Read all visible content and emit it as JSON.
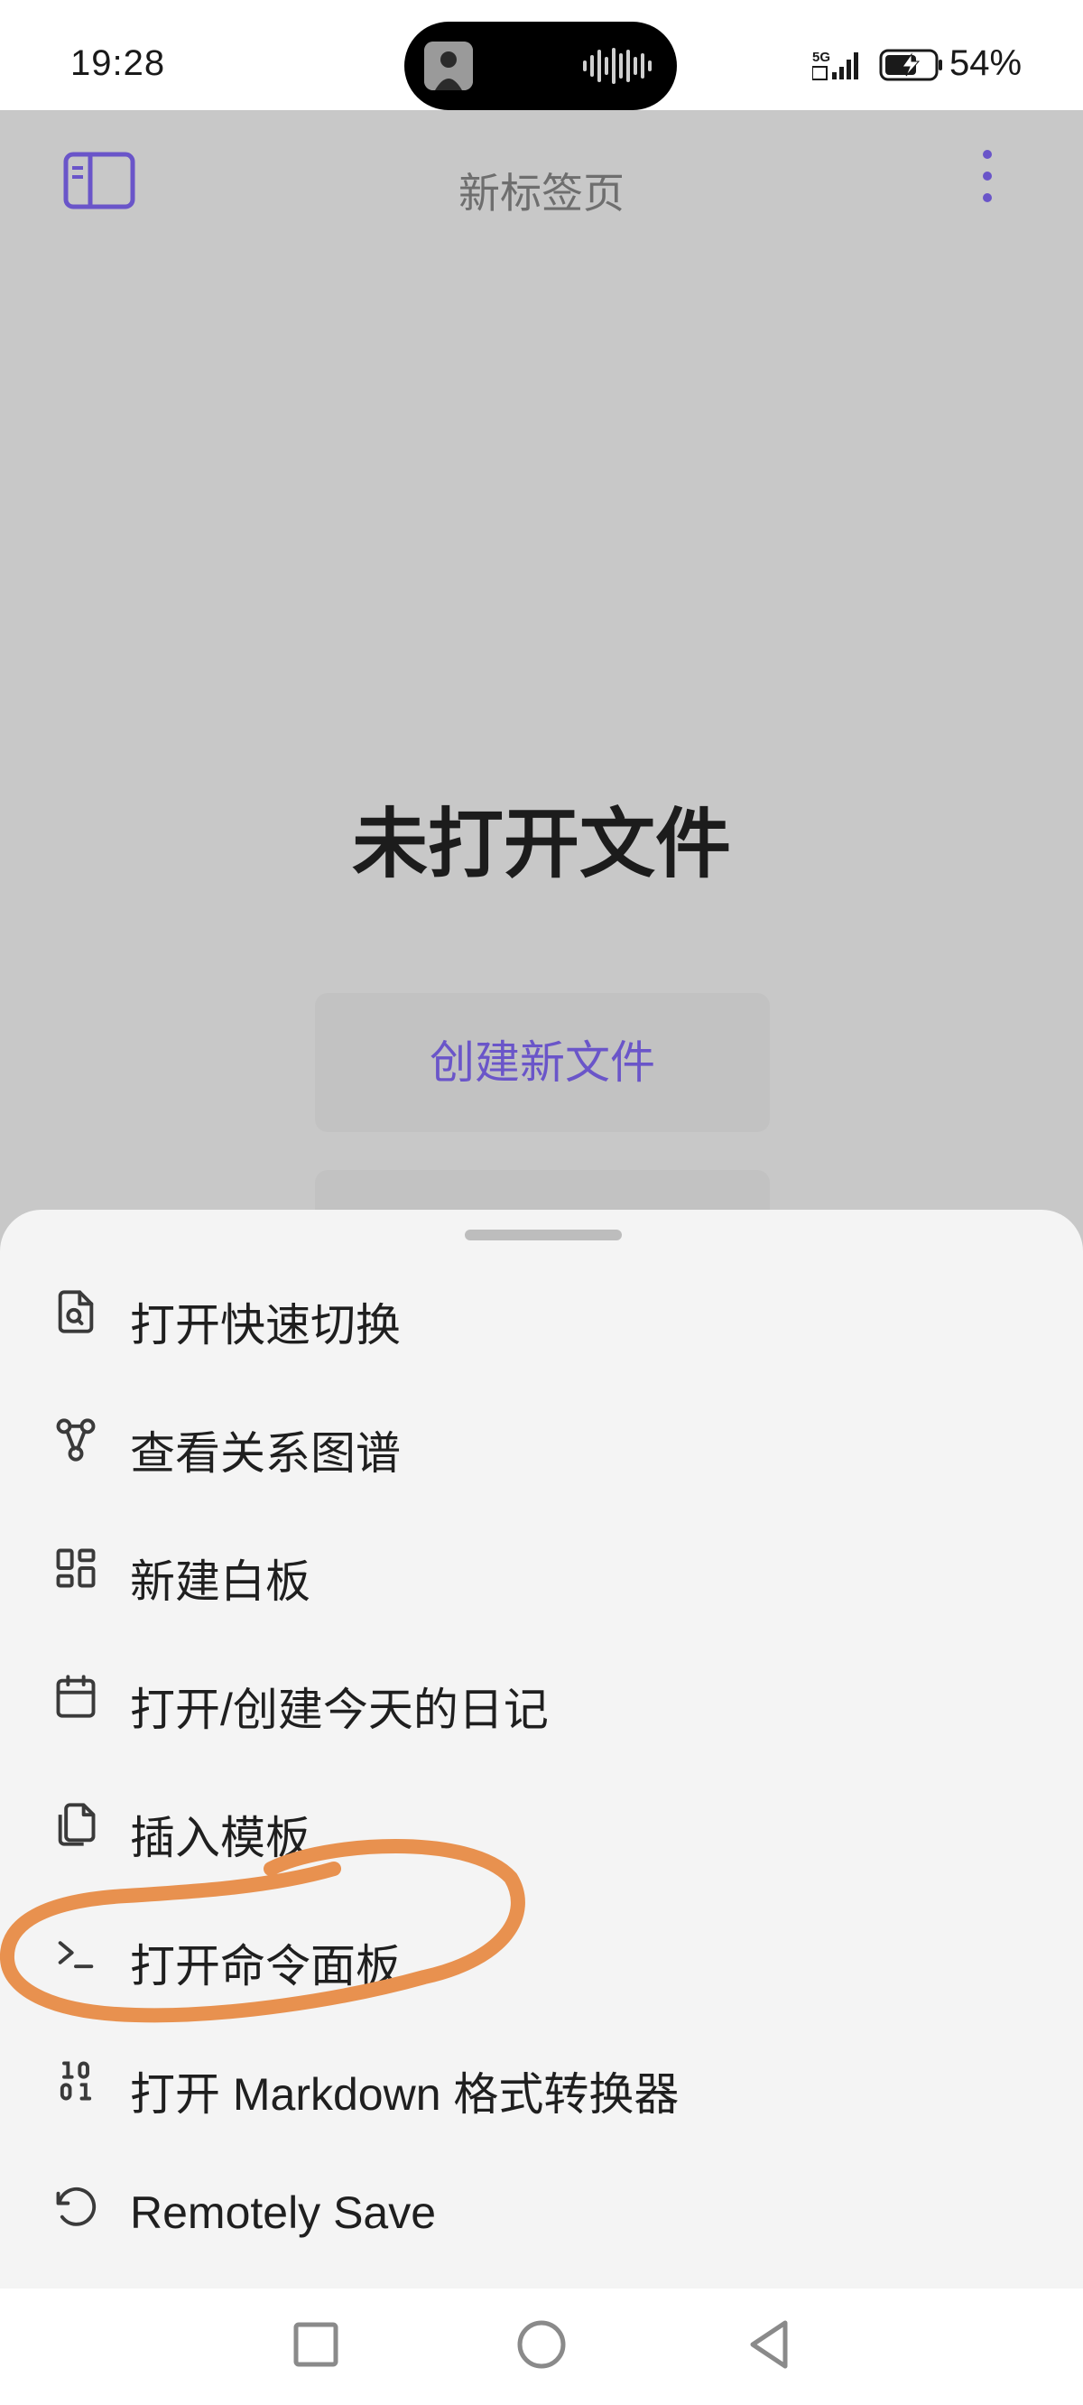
{
  "status_bar": {
    "time": "19:28",
    "signal_label": "5G",
    "battery": "54%"
  },
  "header": {
    "title": "新标签页",
    "sidebar_icon": "sidebar-icon",
    "more_icon": "more-vertical-icon"
  },
  "empty_state": {
    "title": "未打开文件",
    "create_button": "创建新文件"
  },
  "menu": {
    "items": [
      {
        "label": "打开快速切换",
        "icon": "file-search-icon"
      },
      {
        "label": "查看关系图谱",
        "icon": "graph-icon"
      },
      {
        "label": "新建白板",
        "icon": "canvas-icon"
      },
      {
        "label": "打开/创建今天的日记",
        "icon": "calendar-icon"
      },
      {
        "label": "插入模板",
        "icon": "copy-icon"
      },
      {
        "label": "打开命令面板",
        "icon": "terminal-icon"
      },
      {
        "label": "打开 Markdown 格式转换器",
        "icon": "binary-icon"
      },
      {
        "label": "Remotely Save",
        "icon": "rotate-ccw-icon"
      }
    ]
  },
  "nav": {
    "recents": "square-icon",
    "home": "circle-icon",
    "back": "triangle-icon"
  },
  "colors": {
    "accent": "#6a55c9",
    "annotation": "#e8914f",
    "scrim": "#c8c8c8",
    "sheet": "#f4f4f4"
  }
}
